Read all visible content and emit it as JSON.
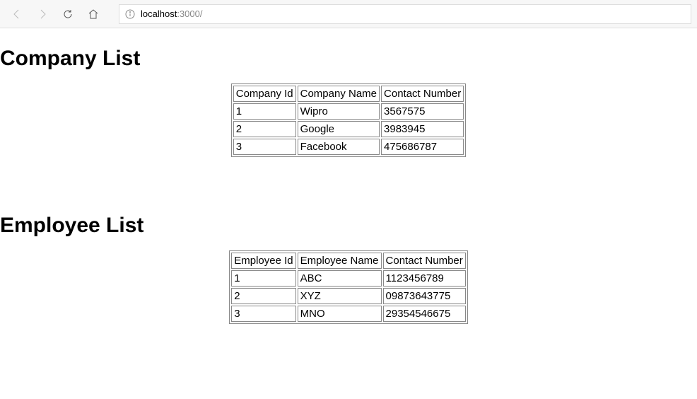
{
  "browser": {
    "url_host": "localhost",
    "url_rest": ":3000/"
  },
  "sections": {
    "company": {
      "heading": "Company List",
      "headers": [
        "Company Id",
        "Company Name",
        "Contact Number"
      ],
      "rows": [
        [
          "1",
          "Wipro",
          "3567575"
        ],
        [
          "2",
          "Google",
          "3983945"
        ],
        [
          "3",
          "Facebook",
          "475686787"
        ]
      ]
    },
    "employee": {
      "heading": "Employee List",
      "headers": [
        "Employee Id",
        "Employee Name",
        "Contact Number"
      ],
      "rows": [
        [
          "1",
          "ABC",
          "1123456789"
        ],
        [
          "2",
          "XYZ",
          "09873643775"
        ],
        [
          "3",
          "MNO",
          "29354546675"
        ]
      ]
    }
  }
}
